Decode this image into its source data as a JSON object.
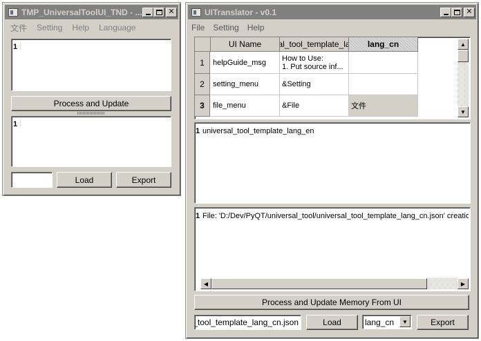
{
  "left_window": {
    "title": "TMP_UniversalToolUI_TND - ...",
    "menu": [
      "文件",
      "Setting",
      "Help",
      "Language"
    ],
    "editor_top_line": "1",
    "process_button": "Process and Update",
    "editor_bottom_line": "1",
    "name_input": "",
    "load_button": "Load",
    "export_button": "Export"
  },
  "right_window": {
    "title": "UITranslator - v0.1",
    "menu": [
      "File",
      "Setting",
      "Help"
    ],
    "table": {
      "headers": [
        "UI Name",
        "al_tool_template_la",
        "lang_cn"
      ],
      "rows": [
        {
          "num": "1",
          "name": "helpGuide_msg",
          "en_line1": "How to Use:",
          "en_line2": "1. Put source inf...",
          "cn": ""
        },
        {
          "num": "2",
          "name": "setting_menu",
          "en_line1": "&Setting",
          "en_line2": "",
          "cn": ""
        },
        {
          "num": "3",
          "name": "file_menu",
          "en_line1": "&File",
          "en_line2": "",
          "cn": "文件"
        }
      ]
    },
    "lang_list_line": "1",
    "lang_list_text": "universal_tool_template_lang_en",
    "log_line": "1",
    "log_text": "File: 'D:/Dev/PyQT/universal_tool/universal_tool_template_lang_cn.json' creatio",
    "process_button": "Process and Update Memory From UI",
    "file_input": "al_tool_template_lang_cn.json",
    "load_button": "Load",
    "lang_select": "lang_cn",
    "export_button": "Export"
  }
}
